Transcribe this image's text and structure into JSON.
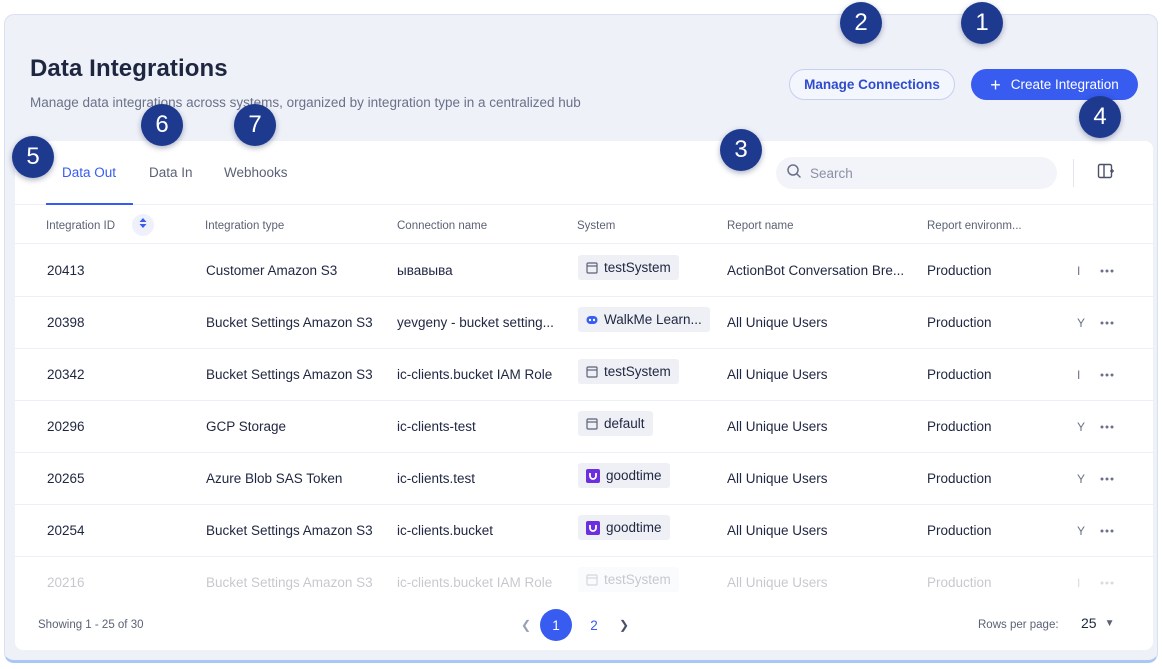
{
  "header": {
    "title": "Data Integrations",
    "subtitle": "Manage data integrations across systems, organized by integration type in a centralized hub",
    "manage_connections_label": "Manage Connections",
    "create_integration_label": "Create Integration",
    "accent_color": "#385bf0"
  },
  "tabs": [
    {
      "label": "Data Out",
      "active": true
    },
    {
      "label": "Data In",
      "active": false
    },
    {
      "label": "Webhooks",
      "active": false
    }
  ],
  "search": {
    "placeholder": "Search",
    "value": ""
  },
  "table": {
    "columns": [
      "Integration ID",
      "Integration type",
      "Connection name",
      "System",
      "Report name",
      "Report environm..."
    ],
    "rows": [
      {
        "id": "20413",
        "type": "Customer Amazon S3",
        "connection": "ывавыва",
        "system": "testSystem",
        "system_icon": "window-icon",
        "report": "ActionBot Conversation Bre...",
        "environment": "Production",
        "trunc": "I"
      },
      {
        "id": "20398",
        "type": "Bucket Settings Amazon S3",
        "connection": "yevgeny - bucket setting...",
        "system": "WalkMe Learn...",
        "system_icon": "walkme-icon",
        "report": "All Unique Users",
        "environment": "Production",
        "trunc": "Y"
      },
      {
        "id": "20342",
        "type": "Bucket Settings Amazon S3",
        "connection": "ic-clients.bucket IAM Role",
        "system": "testSystem",
        "system_icon": "window-icon",
        "report": "All Unique Users",
        "environment": "Production",
        "trunc": "I"
      },
      {
        "id": "20296",
        "type": "GCP Storage",
        "connection": "ic-clients-test",
        "system": "default",
        "system_icon": "window-icon",
        "report": "All Unique Users",
        "environment": "Production",
        "trunc": "Y"
      },
      {
        "id": "20265",
        "type": "Azure Blob SAS Token",
        "connection": "ic-clients.test",
        "system": "goodtime",
        "system_icon": "goodtime-icon",
        "report": "All Unique Users",
        "environment": "Production",
        "trunc": "Y"
      },
      {
        "id": "20254",
        "type": "Bucket Settings Amazon S3",
        "connection": "ic-clients.bucket",
        "system": "goodtime",
        "system_icon": "goodtime-icon",
        "report": "All Unique Users",
        "environment": "Production",
        "trunc": "Y"
      },
      {
        "id": "20216",
        "type": "Bucket Settings Amazon S3",
        "connection": "ic-clients.bucket IAM Role",
        "system": "testSystem",
        "system_icon": "window-icon",
        "report": "All Unique Users",
        "environment": "Production",
        "trunc": "I"
      }
    ]
  },
  "footer": {
    "showing": "Showing 1 - 25 of 30",
    "pages": [
      "1",
      "2"
    ],
    "current_page": "1",
    "rows_per_page_label": "Rows per page:",
    "rows_per_page": "25"
  },
  "callouts": [
    "1",
    "2",
    "3",
    "4",
    "5",
    "6",
    "7"
  ]
}
